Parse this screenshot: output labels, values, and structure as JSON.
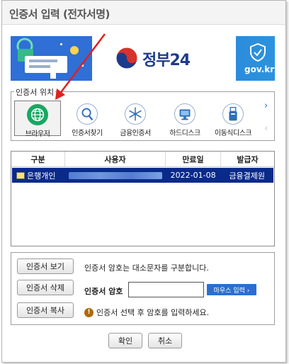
{
  "window": {
    "title": "인증서 입력 (전자서명)"
  },
  "banner": {
    "gov_name": "정부24",
    "domain": "gov.kr"
  },
  "location": {
    "legend": "인증서 위치",
    "items": [
      {
        "label": "브라우저",
        "icon": "globe-icon",
        "selected": true
      },
      {
        "label": "인증서찾기",
        "icon": "magnifier-icon",
        "selected": false
      },
      {
        "label": "금융인증서",
        "icon": "snowflake-icon",
        "selected": false
      },
      {
        "label": "하드디스크",
        "icon": "monitor-icon",
        "selected": false
      },
      {
        "label": "이동식디스크",
        "icon": "usb-drive-icon",
        "selected": false
      }
    ],
    "next_icon": "chevron-right-icon",
    "prev_icon": "chevron-left-icon"
  },
  "table": {
    "headers": [
      "구분",
      "사용자",
      "만료일",
      "발급자"
    ],
    "rows": [
      {
        "type": "은행개인",
        "user": "",
        "expiry": "2022-01-08",
        "issuer": "금융결제원",
        "selected": true
      }
    ]
  },
  "actions": {
    "view": "인증서 보기",
    "delete": "인증서 삭제",
    "copy": "인증서 복사"
  },
  "password": {
    "info": "인증서 암호는 대소문자를 구분합니다.",
    "label": "인증서 암호",
    "value": "",
    "mouse_input": "마우스 입력 ›",
    "warning": "인증서 선택 후 암호를 입력하세요."
  },
  "footer": {
    "ok": "확인",
    "cancel": "취소"
  },
  "colors": {
    "selected_row": "#0a2a8a",
    "accent": "#2a6fd0",
    "arrow": "#e02020"
  }
}
